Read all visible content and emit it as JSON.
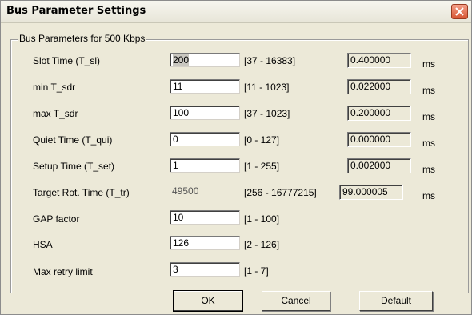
{
  "dialog": {
    "title": "Bus Parameter Settings",
    "group_label": "Bus Parameters for 500 Kbps"
  },
  "params": [
    {
      "label": "Slot Time (T_sl)",
      "value": "200",
      "range": "[37 - 16383]",
      "computed": "0.400000",
      "unit": "ms"
    },
    {
      "label": "min T_sdr",
      "value": "11",
      "range": "[11 - 1023]",
      "computed": "0.022000",
      "unit": "ms"
    },
    {
      "label": "max T_sdr",
      "value": "100",
      "range": "[37 - 1023]",
      "computed": "0.200000",
      "unit": "ms"
    },
    {
      "label": "Quiet Time (T_qui)",
      "value": "0",
      "range": "[0 - 127]",
      "computed": "0.000000",
      "unit": "ms"
    },
    {
      "label": "Setup Time (T_set)",
      "value": "1",
      "range": "[1 - 255]",
      "computed": "0.002000",
      "unit": "ms"
    },
    {
      "label": "Target Rot. Time (T_tr)",
      "value": "49500",
      "range": "[256 - 16777215]",
      "computed": "99.000005",
      "unit": "ms"
    },
    {
      "label": "GAP factor",
      "value": "10",
      "range": "[1 - 100]"
    },
    {
      "label": "HSA",
      "value": "126",
      "range": "[2 - 126]"
    },
    {
      "label": "Max retry limit",
      "value": "3",
      "range": "[1 - 7]"
    }
  ],
  "buttons": {
    "ok": "OK",
    "cancel": "Cancel",
    "default": "Default"
  }
}
